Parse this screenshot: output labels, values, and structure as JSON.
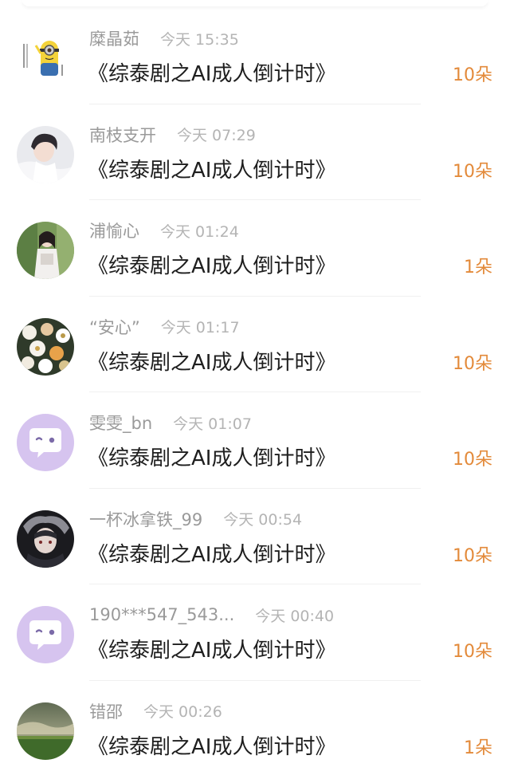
{
  "colors": {
    "username": "#9a9a9a",
    "time": "#b4b4b4",
    "title": "#1e1e1e",
    "gift_count": "#e38a3a",
    "default_avatar_bg": "#d6c4ef"
  },
  "rows": [
    {
      "username": "糜晶茹",
      "time": "今天 15:35",
      "title": "《综泰剧之AI成人倒计时》",
      "gift": "10朵",
      "avatar": "minion-avatar"
    },
    {
      "username": "南枝支开",
      "time": "今天 07:29",
      "title": "《综泰剧之AI成人倒计时》",
      "gift": "10朵",
      "avatar": "portrait-avatar"
    },
    {
      "username": "浦愉心",
      "time": "今天 01:24",
      "title": "《综泰剧之AI成人倒计时》",
      "gift": "1朵",
      "avatar": "photo-avatar"
    },
    {
      "username": "“安心”",
      "time": "今天 01:17",
      "title": "《综泰剧之AI成人倒计时》",
      "gift": "10朵",
      "avatar": "flowers-avatar"
    },
    {
      "username": "雯雯_bn",
      "time": "今天 01:07",
      "title": "《综泰剧之AI成人倒计时》",
      "gift": "10朵",
      "avatar": "default-chat-avatar"
    },
    {
      "username": "一杯冰拿铁_99",
      "time": "今天 00:54",
      "title": "《综泰剧之AI成人倒计时》",
      "gift": "10朵",
      "avatar": "anime-avatar"
    },
    {
      "username": "190***547_543...",
      "time": "今天 00:40",
      "title": "《综泰剧之AI成人倒计时》",
      "gift": "10朵",
      "avatar": "default-chat-avatar"
    },
    {
      "username": "错邵",
      "time": "今天 00:26",
      "title": "《综泰剧之AI成人倒计时》",
      "gift": "1朵",
      "avatar": "landscape-avatar"
    }
  ]
}
